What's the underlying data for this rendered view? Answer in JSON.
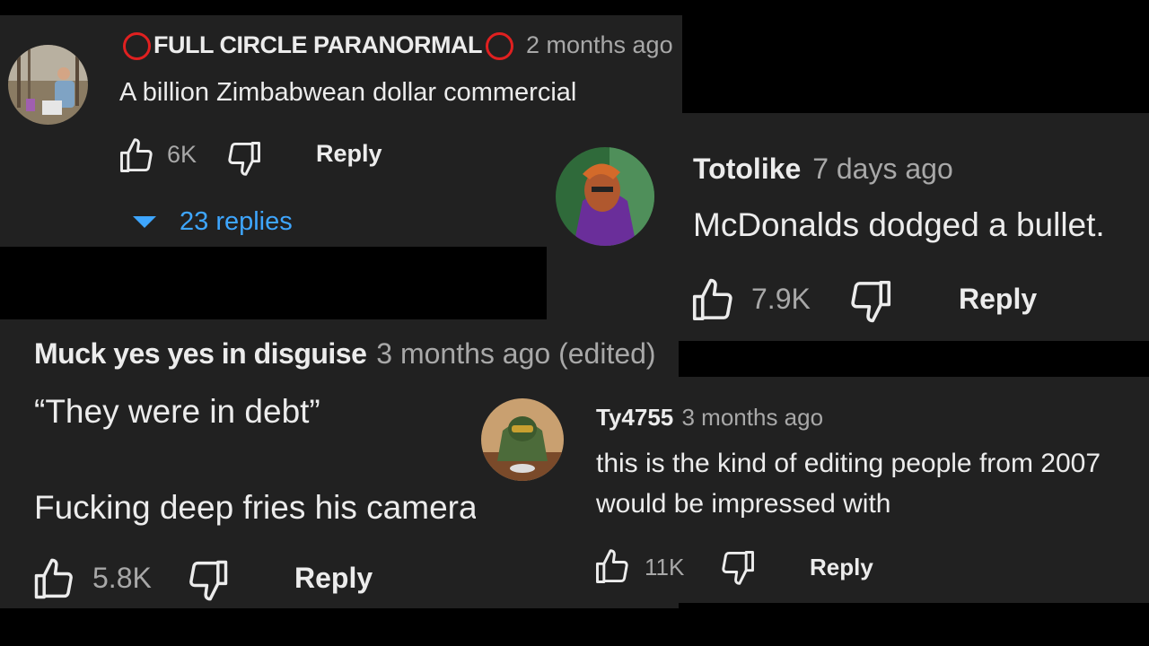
{
  "comments": [
    {
      "author": "FULL CIRCLE PARANORMAL",
      "time": "2 months ago",
      "text": "A billion Zimbabwean dollar commercial",
      "likes": "6K",
      "reply_label": "Reply",
      "replies_label": "23 replies"
    },
    {
      "author": "Totolike",
      "time": "7 days ago",
      "text": "McDonalds dodged a bullet.",
      "likes": "7.9K",
      "reply_label": "Reply"
    },
    {
      "author": "Muck yes yes in disguise",
      "time": "3 months ago (edited)",
      "text_line1": "“They were in debt”",
      "text_line2": "Fucking deep fries his camera",
      "likes": "5.8K",
      "reply_label": "Reply"
    },
    {
      "author": "Ty4755",
      "time": "3 months ago",
      "text_line1": "this is the kind of editing people from 2007",
      "text_line2": "would be impressed with",
      "likes": "11K",
      "reply_label": "Reply"
    }
  ],
  "colors": {
    "background": "#000000",
    "card": "#212121",
    "text": "#ececec",
    "muted": "#a8a8a8",
    "link": "#3ea6ff",
    "badge_red": "#e02020"
  },
  "icons": [
    "thumbs-up-icon",
    "thumbs-down-icon",
    "caret-down-icon",
    "red-circle-icon"
  ]
}
